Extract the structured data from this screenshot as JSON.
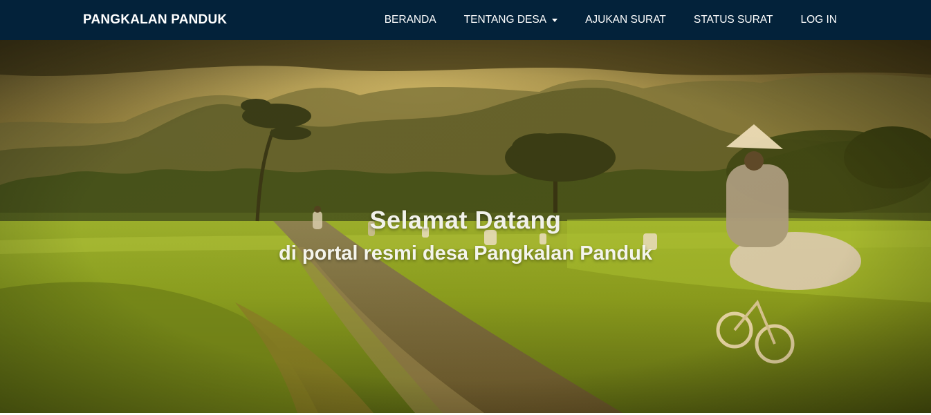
{
  "navbar": {
    "brand": "PANGKALAN PANDUK",
    "links": [
      {
        "label": "BERANDA",
        "has_dropdown": false
      },
      {
        "label": "TENTANG DESA",
        "has_dropdown": true
      },
      {
        "label": "AJUKAN SURAT",
        "has_dropdown": false
      },
      {
        "label": "STATUS SURAT",
        "has_dropdown": false
      },
      {
        "label": "LOG IN",
        "has_dropdown": false
      }
    ],
    "background_color": "#03223a"
  },
  "hero": {
    "title": "Selamat Datang",
    "subtitle": "di portal resmi desa Pangkalan Panduk",
    "image_description_icon": "rice-field-landscape-photo"
  }
}
